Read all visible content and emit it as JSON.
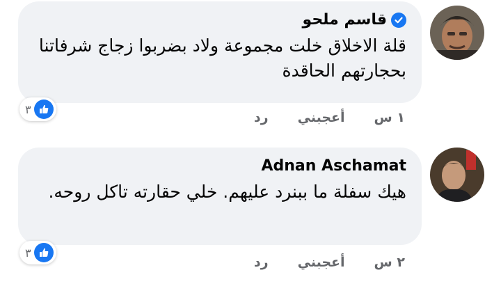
{
  "comments": [
    {
      "author": "قاسم ملحو",
      "verified": true,
      "text": "قلة الاخلاق خلت مجموعة ولاد بضربوا زجاج شرفاتنا بحجارتهم الحاقدة",
      "reaction_count": "٣",
      "time": "١ س",
      "like_label": "أعجبني",
      "reply_label": "رد"
    },
    {
      "author": "Adnan Aschamat",
      "verified": false,
      "text": "هيك سفلة ما ببنرد عليهم. خلي حقارته تاكل روحه.",
      "reaction_count": "٣",
      "time": "٢ س",
      "like_label": "أعجبني",
      "reply_label": "رد"
    }
  ],
  "colors": {
    "bubble": "#f0f2f5",
    "accent": "#1877f2",
    "meta": "#65676b"
  },
  "icons": [
    "verified-badge-icon",
    "like-thumb-icon"
  ]
}
